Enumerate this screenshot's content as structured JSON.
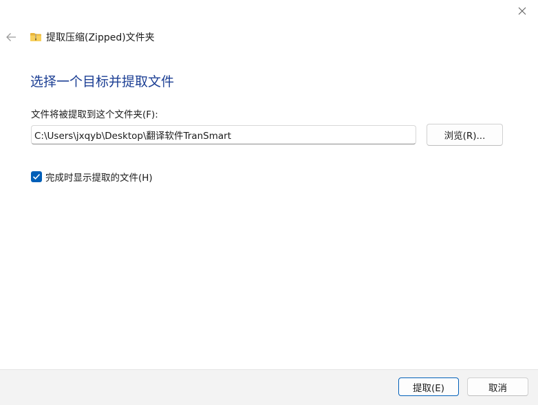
{
  "window": {
    "title": "提取压缩(Zipped)文件夹",
    "close_icon": "close-icon",
    "back_icon": "back-arrow-icon",
    "folder_icon": "zipped-folder-icon"
  },
  "main": {
    "instruction": "选择一个目标并提取文件",
    "dest_label": "文件将被提取到这个文件夹(F):",
    "path_value": "C:\\Users\\jxqyb\\Desktop\\翻译软件TranSmart",
    "browse_label": "浏览(R)...",
    "show_files_label": "完成时显示提取的文件(H)",
    "show_files_checked": true
  },
  "footer": {
    "extract_label": "提取(E)",
    "cancel_label": "取消"
  },
  "colors": {
    "accent": "#005fb8",
    "instruction_text": "#1c3f94",
    "footer_bg": "#f3f3f3"
  }
}
